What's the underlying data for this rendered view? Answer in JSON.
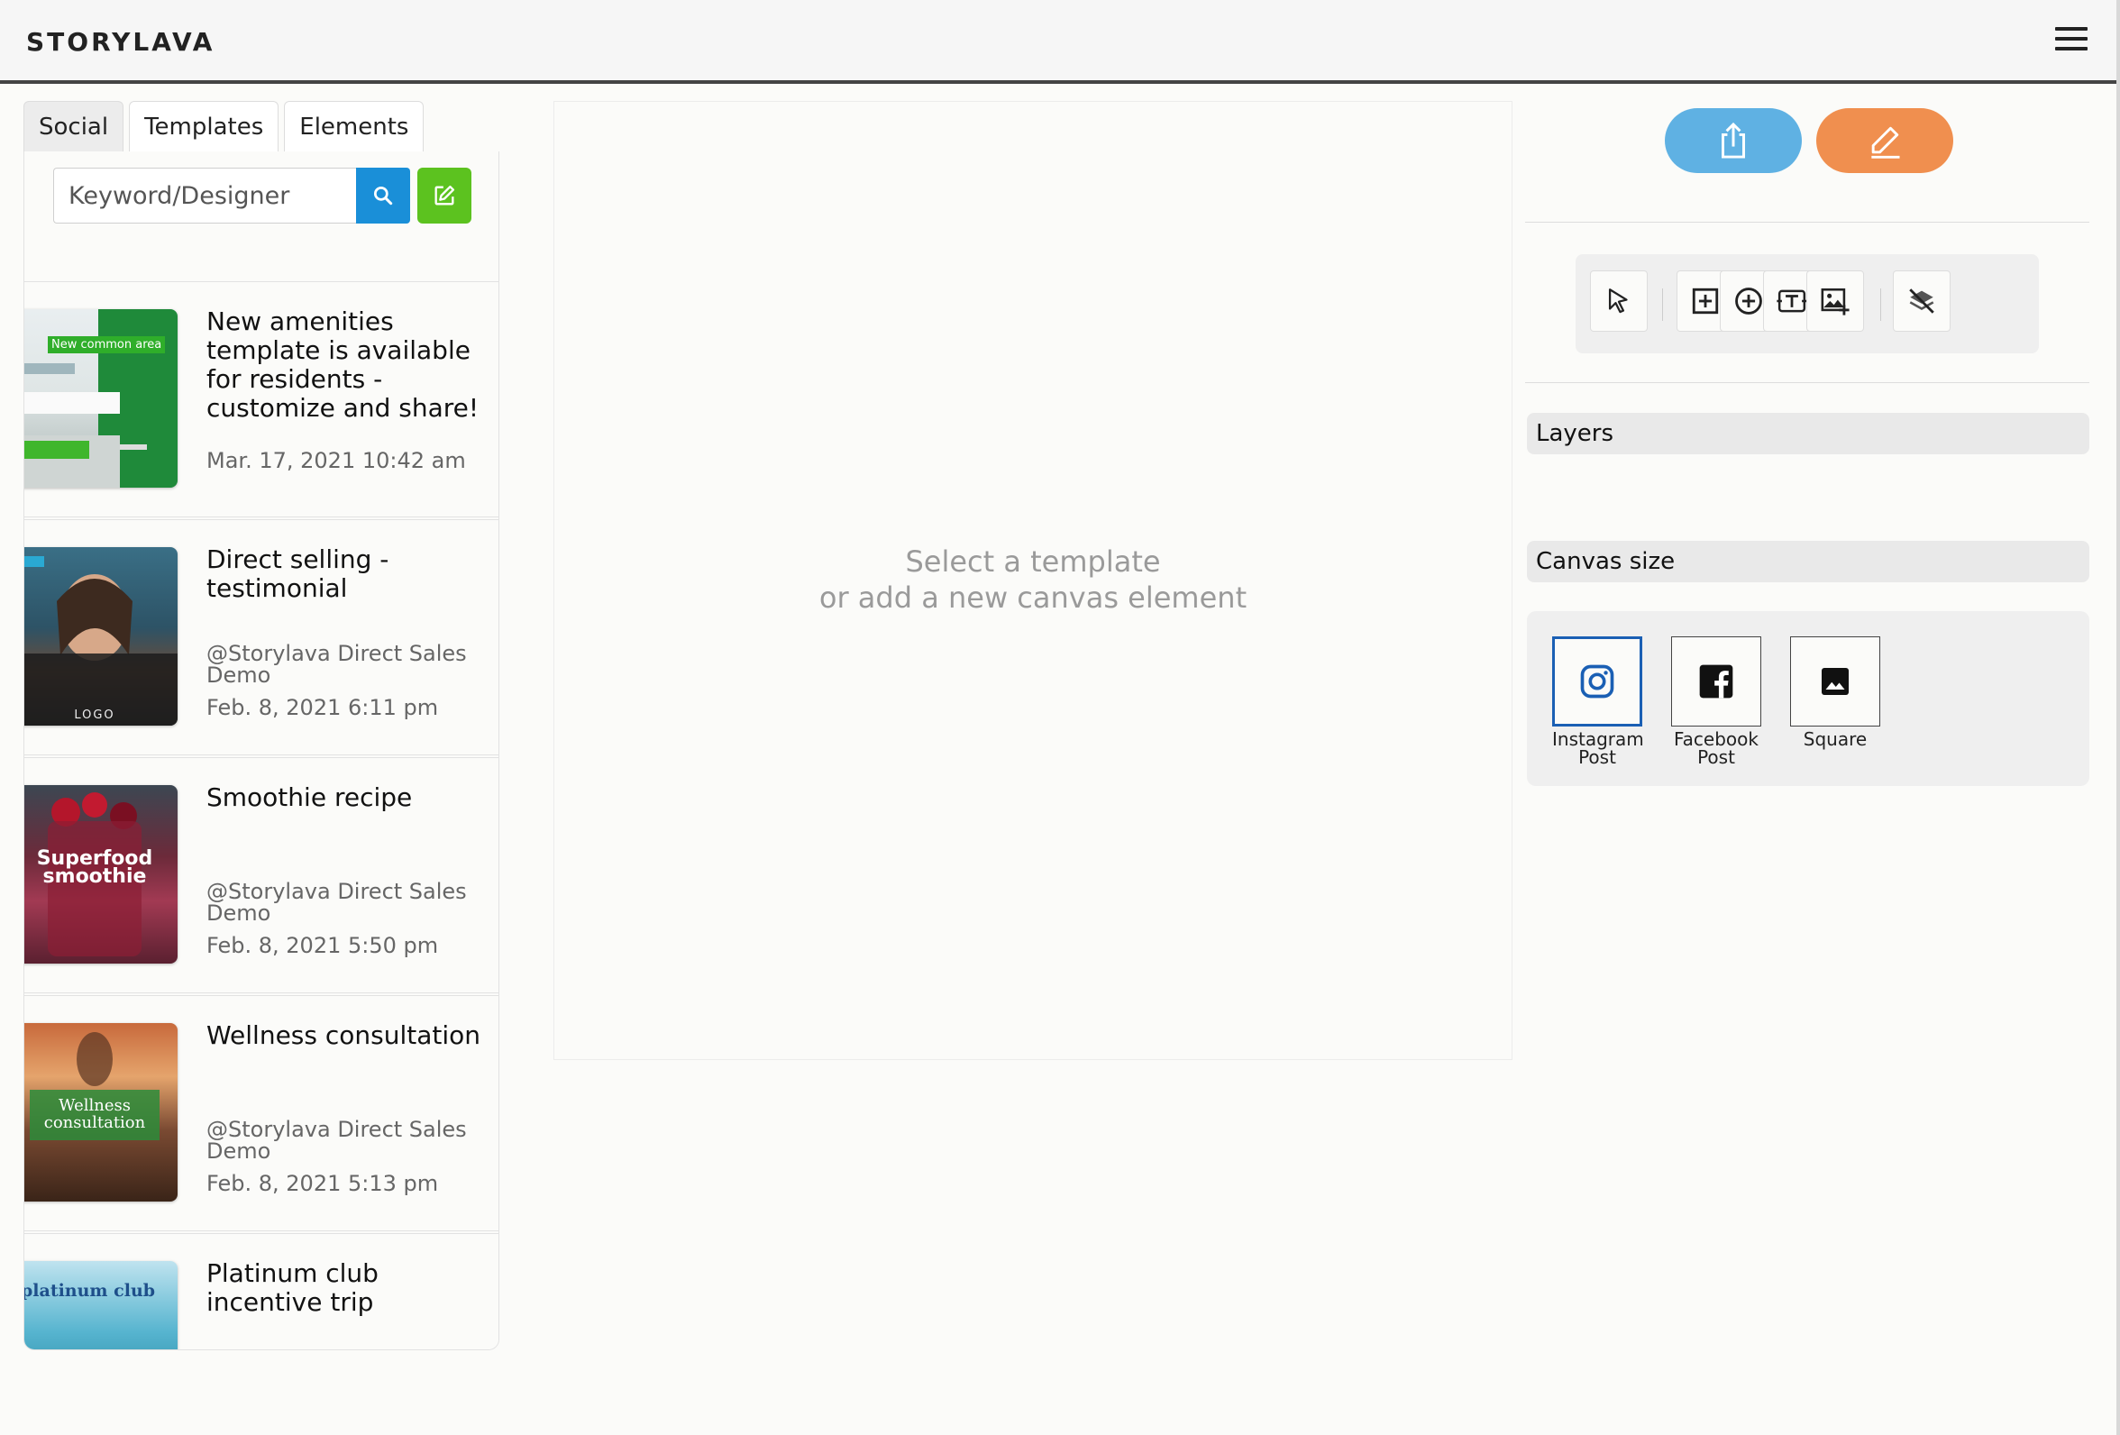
{
  "header": {
    "logo": "STORYLAVA"
  },
  "tabs": [
    {
      "label": "Social"
    },
    {
      "label": "Templates"
    },
    {
      "label": "Elements"
    }
  ],
  "search": {
    "placeholder": "Keyword/Designer"
  },
  "cards": [
    {
      "title": "New amenities template is available for residents - customize and share!",
      "author": "",
      "date": "Mar. 17, 2021 10:42 am",
      "thumb_text": "New common area"
    },
    {
      "title": "Direct selling - testimonial",
      "author": "@Storylava Direct Sales Demo",
      "date": "Feb. 8, 2021 6:11 pm",
      "thumb_text": "LOGO"
    },
    {
      "title": "Smoothie recipe",
      "author": "@Storylava Direct Sales Demo",
      "date": "Feb. 8, 2021 5:50 pm",
      "thumb_text": "Superfood smoothie"
    },
    {
      "title": "Wellness consultation",
      "author": "@Storylava Direct Sales Demo",
      "date": "Feb. 8, 2021 5:13 pm",
      "thumb_text": "Wellness consultation"
    },
    {
      "title": "Platinum club incentive trip",
      "author": "",
      "date": "",
      "thumb_text": "platinum club"
    }
  ],
  "canvas": {
    "line1": "Select a template",
    "line2": "or add a new canvas element"
  },
  "panels": {
    "layers": "Layers",
    "canvas_size": "Canvas size"
  },
  "canvas_sizes": [
    {
      "label": "Instagram Post",
      "icon": "instagram-icon",
      "selected": true
    },
    {
      "label": "Facebook Post",
      "icon": "facebook-icon",
      "selected": false
    },
    {
      "label": "Square",
      "icon": "image-icon",
      "selected": false
    }
  ],
  "colors": {
    "share": "#5fb1e3",
    "edit": "#f08f4f",
    "search": "#1a8fd8",
    "new": "#5cc21f",
    "selected_size": "#1a5fb4"
  }
}
